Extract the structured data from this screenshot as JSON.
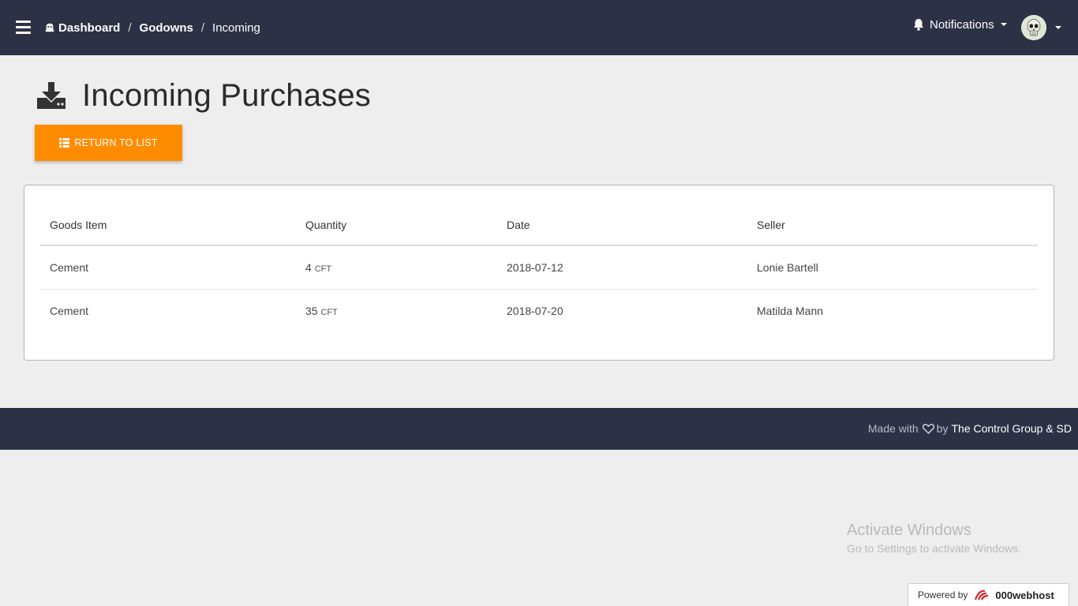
{
  "topbar": {
    "breadcrumb": [
      {
        "label": "Dashboard"
      },
      {
        "label": "Godowns"
      },
      {
        "label": "Incoming"
      }
    ],
    "separator": "/",
    "notifications_label": "Notifications"
  },
  "page": {
    "title": "Incoming Purchases",
    "return_button_label": "RETURN TO LIST"
  },
  "table": {
    "columns": [
      "Goods Item",
      "Quantity",
      "Date",
      "Seller"
    ],
    "rows": [
      {
        "item": "Cement",
        "qty": "4",
        "unit": "CFT",
        "date": "2018-07-12",
        "seller": "Lonie Bartell"
      },
      {
        "item": "Cement",
        "qty": "35",
        "unit": "CFT",
        "date": "2018-07-20",
        "seller": "Matilda Mann"
      }
    ]
  },
  "footer": {
    "made_with": "Made with",
    "by": "by",
    "brand": "The Control Group & SD"
  },
  "overlay": {
    "activate_title": "Activate Windows",
    "activate_sub": "Go to Settings to activate Windows.",
    "powered_by": "Powered by",
    "host": "000webhost"
  },
  "colors": {
    "topbar": "#2c3145",
    "accent": "#ff8c00",
    "background": "#eeeeee"
  },
  "icons": {
    "menu": "hamburger-icon",
    "dashboard": "dashboard-icon",
    "notifications": "bell-icon",
    "title": "download-icon",
    "return": "list-icon",
    "footer": "heart-icon"
  }
}
